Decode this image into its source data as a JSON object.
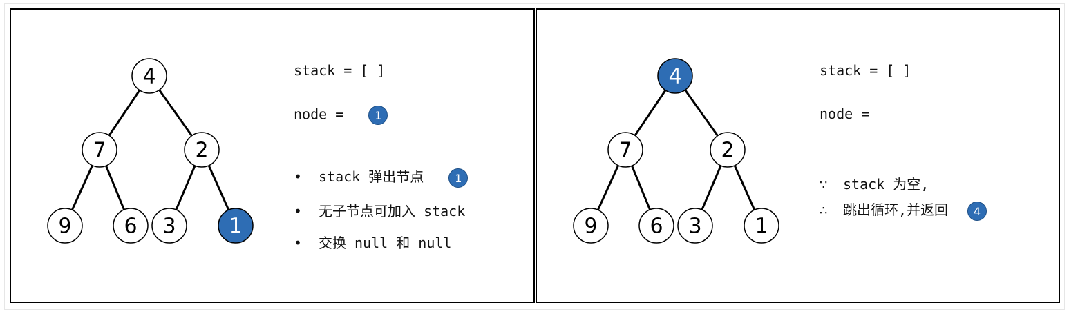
{
  "colors": {
    "highlight_fill": "#2e6db4",
    "node_fill": "#ffffff",
    "stroke": "#000000"
  },
  "left_panel": {
    "tree": {
      "nodes": [
        {
          "id": "root",
          "label": "4",
          "highlight": false
        },
        {
          "id": "l",
          "label": "7",
          "highlight": false
        },
        {
          "id": "r",
          "label": "2",
          "highlight": false
        },
        {
          "id": "ll",
          "label": "9",
          "highlight": false
        },
        {
          "id": "lr",
          "label": "6",
          "highlight": false
        },
        {
          "id": "rl",
          "label": "3",
          "highlight": false
        },
        {
          "id": "rr",
          "label": "1",
          "highlight": true
        }
      ]
    },
    "stack_line": "stack = [ ]",
    "node_label": "node =",
    "node_badge": "1",
    "bullets": {
      "b1_text": "stack 弹出节点",
      "b1_badge": "1",
      "b2_text": "无子节点可加入 stack",
      "b3_text": "交换 null 和 null"
    },
    "bullet_symbol": "•"
  },
  "right_panel": {
    "tree": {
      "nodes": [
        {
          "id": "root",
          "label": "4",
          "highlight": true
        },
        {
          "id": "l",
          "label": "7",
          "highlight": false
        },
        {
          "id": "r",
          "label": "2",
          "highlight": false
        },
        {
          "id": "ll",
          "label": "9",
          "highlight": false
        },
        {
          "id": "lr",
          "label": "6",
          "highlight": false
        },
        {
          "id": "rl",
          "label": "3",
          "highlight": false
        },
        {
          "id": "rr",
          "label": "1",
          "highlight": false
        }
      ]
    },
    "stack_line": "stack = [ ]",
    "node_label": "node =",
    "because_symbol": "∵",
    "because_text": "stack 为空,",
    "therefore_symbol": "∴",
    "therefore_text": "跳出循环,并返回",
    "therefore_badge": "4"
  }
}
